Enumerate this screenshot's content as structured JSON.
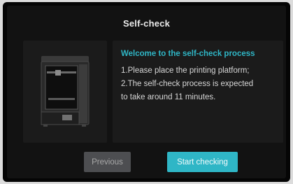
{
  "dialog": {
    "title": "Self-check",
    "heading": "Welcome to the self-check process",
    "lines": [
      "1.Please place the printing platform;",
      "2.The self-check process is expected",
      "to take around 11 minutes."
    ]
  },
  "buttons": {
    "previous": "Previous",
    "start": "Start checking"
  },
  "colors": {
    "accent": "#2fb6c6",
    "panel": "#1b1b1b",
    "background": "#121212",
    "disabled_button": "#4d4e51"
  },
  "icons": {
    "printer": "3d-printer-image"
  }
}
